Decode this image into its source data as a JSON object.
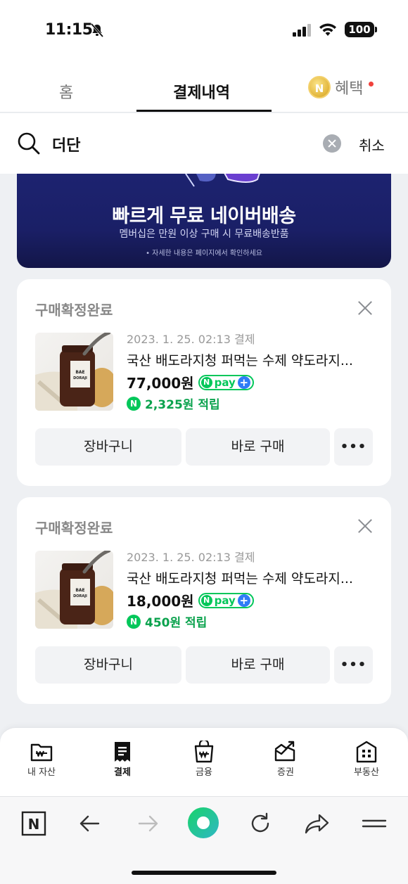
{
  "status_bar": {
    "time": "11:15",
    "battery": "100"
  },
  "tabs": {
    "home": "홈",
    "payments": "결제내역",
    "benefits": "혜택",
    "coin": "N"
  },
  "search": {
    "query": "더단",
    "cancel": "취소"
  },
  "banner": {
    "headline": "빠르게 무료 네이버배송",
    "subtitle": "멤버십은 만원 이상 구매 시 무료배송반품",
    "note": "• 자세한 내용은 페이지에서 확인하세요"
  },
  "orders": [
    {
      "status": "구매확정완료",
      "date": "2023. 1. 25. 02:13 결제",
      "title": "국산 배도라지청 퍼먹는 수제 약도라지...",
      "price": "77,000원",
      "points": "2,325원 적립",
      "cart_label": "장바구니",
      "buy_label": "바로 구매",
      "more_label": "•••"
    },
    {
      "status": "구매확정완료",
      "date": "2023. 1. 25. 02:13 결제",
      "title": "국산 배도라지청 퍼먹는 수제 약도라지...",
      "price": "18,000원",
      "points": "450원 적립",
      "cart_label": "장바구니",
      "buy_label": "바로 구매",
      "more_label": "•••"
    }
  ],
  "npay_badge": {
    "n": "N",
    "pay": "pay",
    "plus": "+"
  },
  "points_icon": "N",
  "product_label": {
    "line1": "BAE",
    "line2": "DORAJI"
  },
  "bottom_nav": [
    {
      "label": "내 자산",
      "icon": "wallet-folder-icon"
    },
    {
      "label": "결제",
      "icon": "receipt-icon"
    },
    {
      "label": "금융",
      "icon": "money-bag-icon"
    },
    {
      "label": "증권",
      "icon": "stock-chart-icon"
    },
    {
      "label": "부동산",
      "icon": "building-icon"
    }
  ],
  "browser_bar": {
    "n_logo": "N"
  },
  "colors": {
    "naver_green": "#03c75a",
    "banner_navy": "#1a1f66",
    "plus_blue": "#2f7cf6"
  }
}
